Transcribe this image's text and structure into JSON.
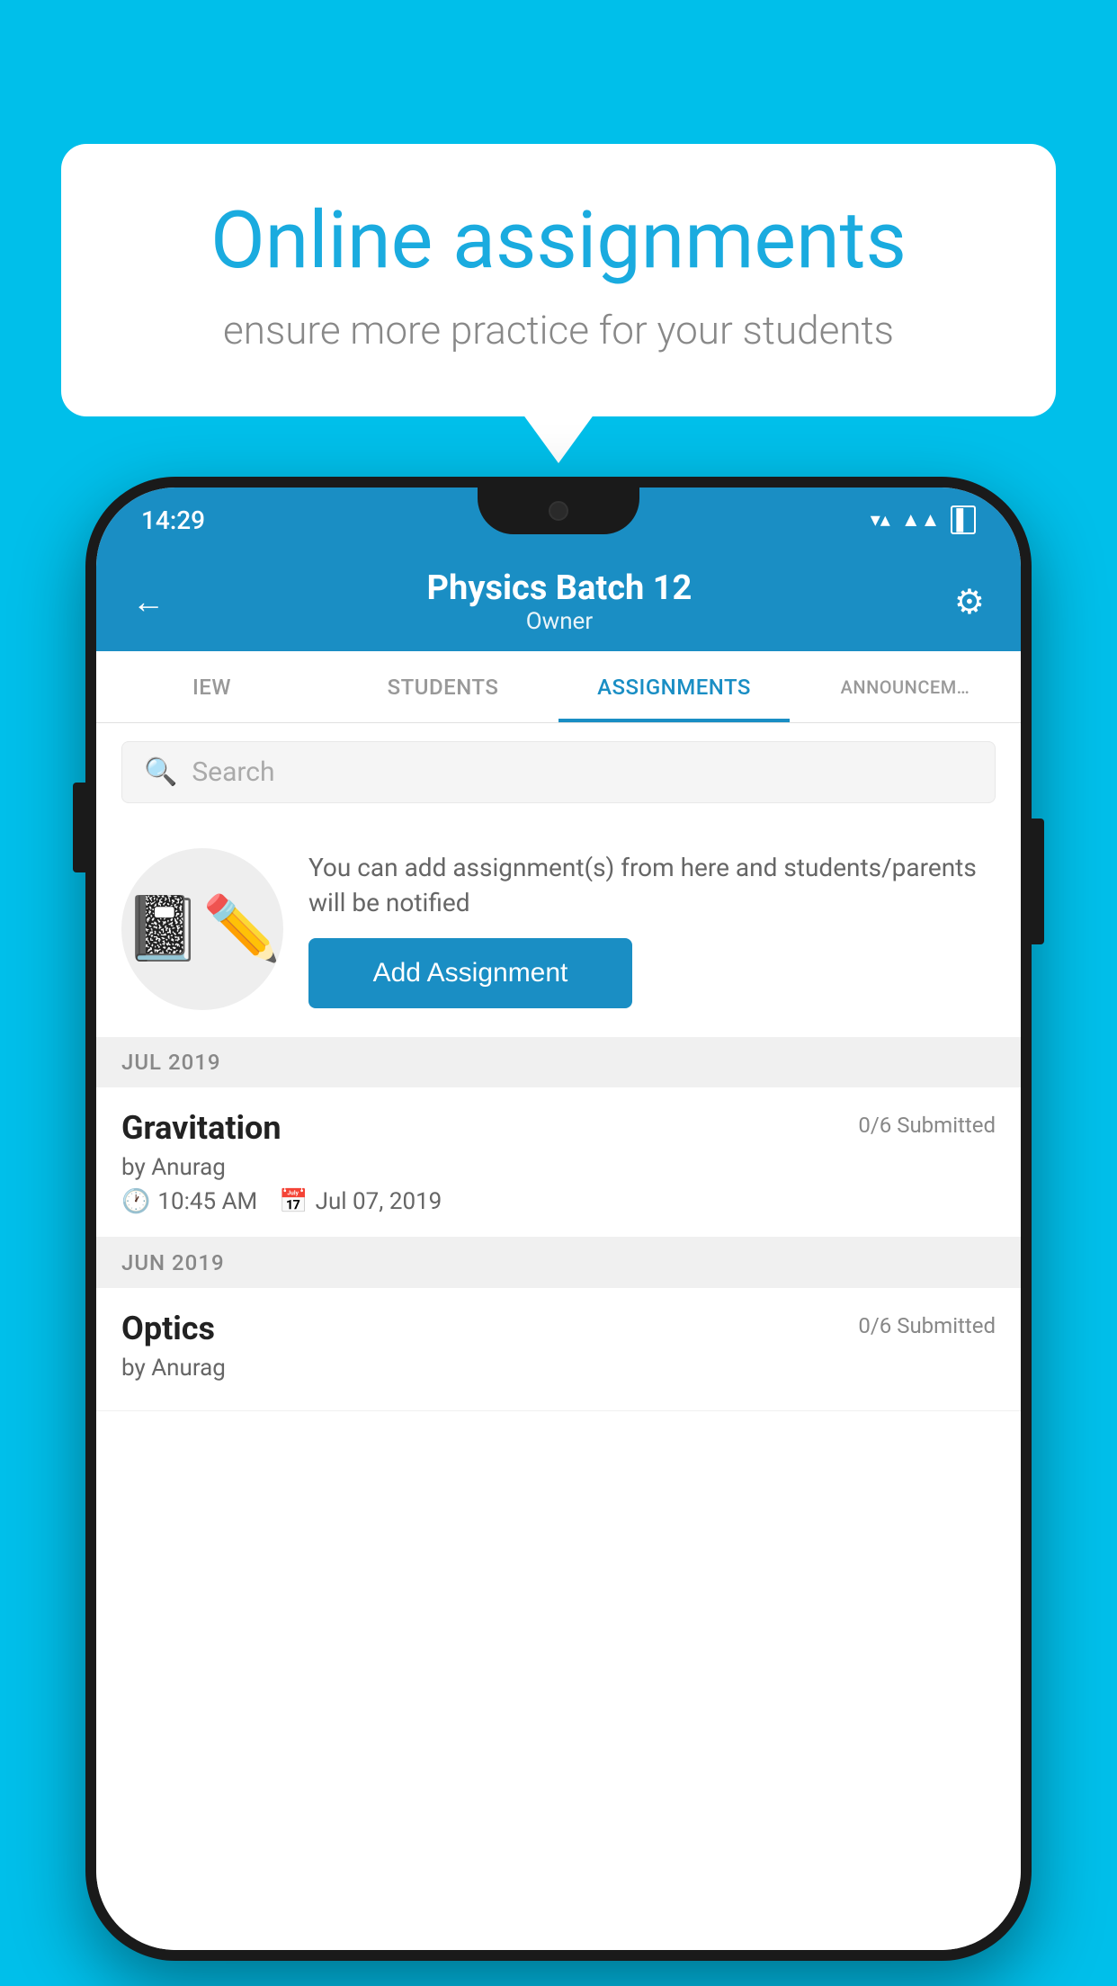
{
  "background_color": "#00BFEA",
  "bubble": {
    "title": "Online assignments",
    "subtitle": "ensure more practice for your students"
  },
  "phone": {
    "status_bar": {
      "time": "14:29",
      "icons": [
        "wifi",
        "signal",
        "battery"
      ]
    },
    "header": {
      "title": "Physics Batch 12",
      "subtitle": "Owner",
      "back_label": "←",
      "settings_label": "⚙"
    },
    "tabs": [
      {
        "label": "IEW",
        "active": false
      },
      {
        "label": "STUDENTS",
        "active": false
      },
      {
        "label": "ASSIGNMENTS",
        "active": true
      },
      {
        "label": "ANNOUNCEM…",
        "active": false
      }
    ],
    "search": {
      "placeholder": "Search"
    },
    "promo": {
      "description": "You can add assignment(s) from here and students/parents will be notified",
      "button_label": "Add Assignment"
    },
    "sections": [
      {
        "label": "JUL 2019",
        "assignments": [
          {
            "name": "Gravitation",
            "submitted": "0/6 Submitted",
            "author": "by Anurag",
            "time": "10:45 AM",
            "date": "Jul 07, 2019"
          }
        ]
      },
      {
        "label": "JUN 2019",
        "assignments": [
          {
            "name": "Optics",
            "submitted": "0/6 Submitted",
            "author": "by Anurag",
            "time": "",
            "date": ""
          }
        ]
      }
    ]
  }
}
